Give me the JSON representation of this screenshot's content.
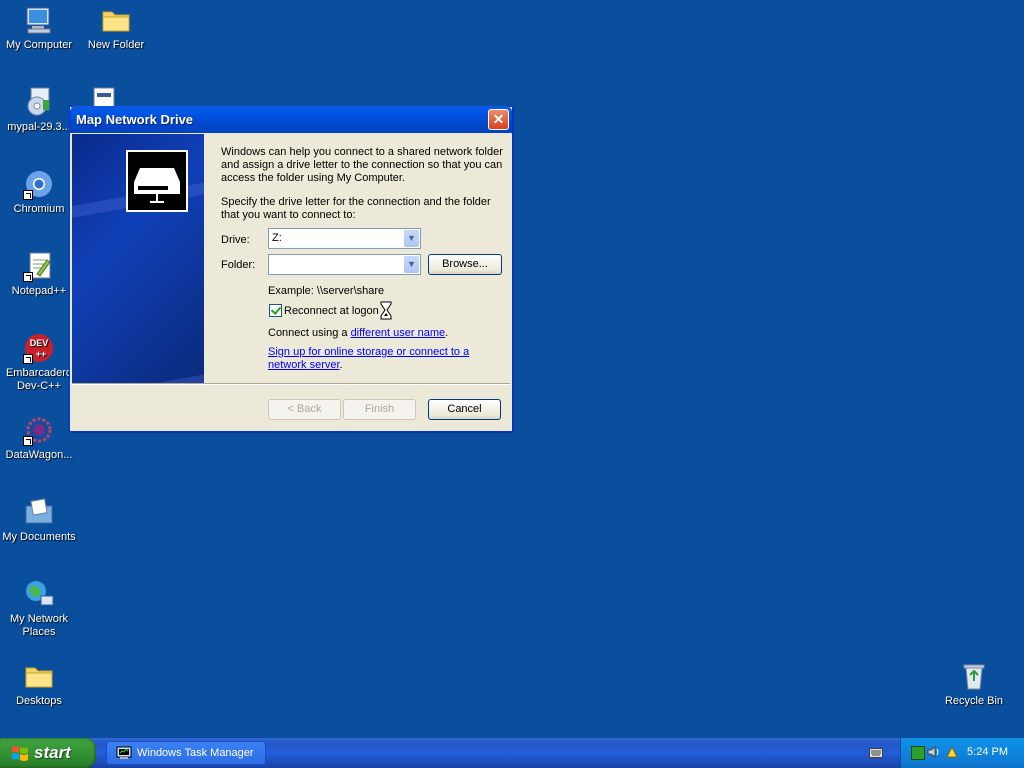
{
  "desktop": {
    "icons": [
      {
        "label": "My Computer"
      },
      {
        "label": "New Folder"
      },
      {
        "label": "mypal-29.3..."
      },
      {
        "label": "Chromium"
      },
      {
        "label": "Notepad++"
      },
      {
        "label": "Embarcadero Dev-C++"
      },
      {
        "label": "DataWagon..."
      },
      {
        "label": "My Documents"
      },
      {
        "label": "My Network Places"
      },
      {
        "label": "Desktops"
      },
      {
        "label": "Recycle Bin"
      }
    ]
  },
  "dialog": {
    "title": "Map Network Drive",
    "close_glyph": "✕",
    "intro": "Windows can help you connect to a shared network folder and assign a drive letter to the connection so that you can access the folder using My Computer.",
    "instruction": "Specify the drive letter for the connection and the folder that you want to connect to:",
    "drive_label": "Drive:",
    "drive_value": "Z:",
    "folder_label": "Folder:",
    "folder_value": "",
    "browse_label": "Browse...",
    "example": "Example: \\\\server\\share",
    "reconnect_label": "Reconnect at logon",
    "reconnect_checked": true,
    "connect_using_prefix": "Connect using a ",
    "connect_using_link": "different user name",
    "connect_using_suffix": ".",
    "signup_link": "Sign up for online storage or connect to a network server",
    "signup_suffix": ".",
    "back_label": "< Back",
    "finish_label": "Finish",
    "cancel_label": "Cancel"
  },
  "taskbar": {
    "start_label": "start",
    "task_button": "Windows Task Manager",
    "clock": "5:24 PM"
  },
  "colors": {
    "desktop_bg": "#0a4f9e",
    "titlebar": "#0054e3",
    "start_green": "#3c9a3c",
    "link": "#0000ff"
  }
}
